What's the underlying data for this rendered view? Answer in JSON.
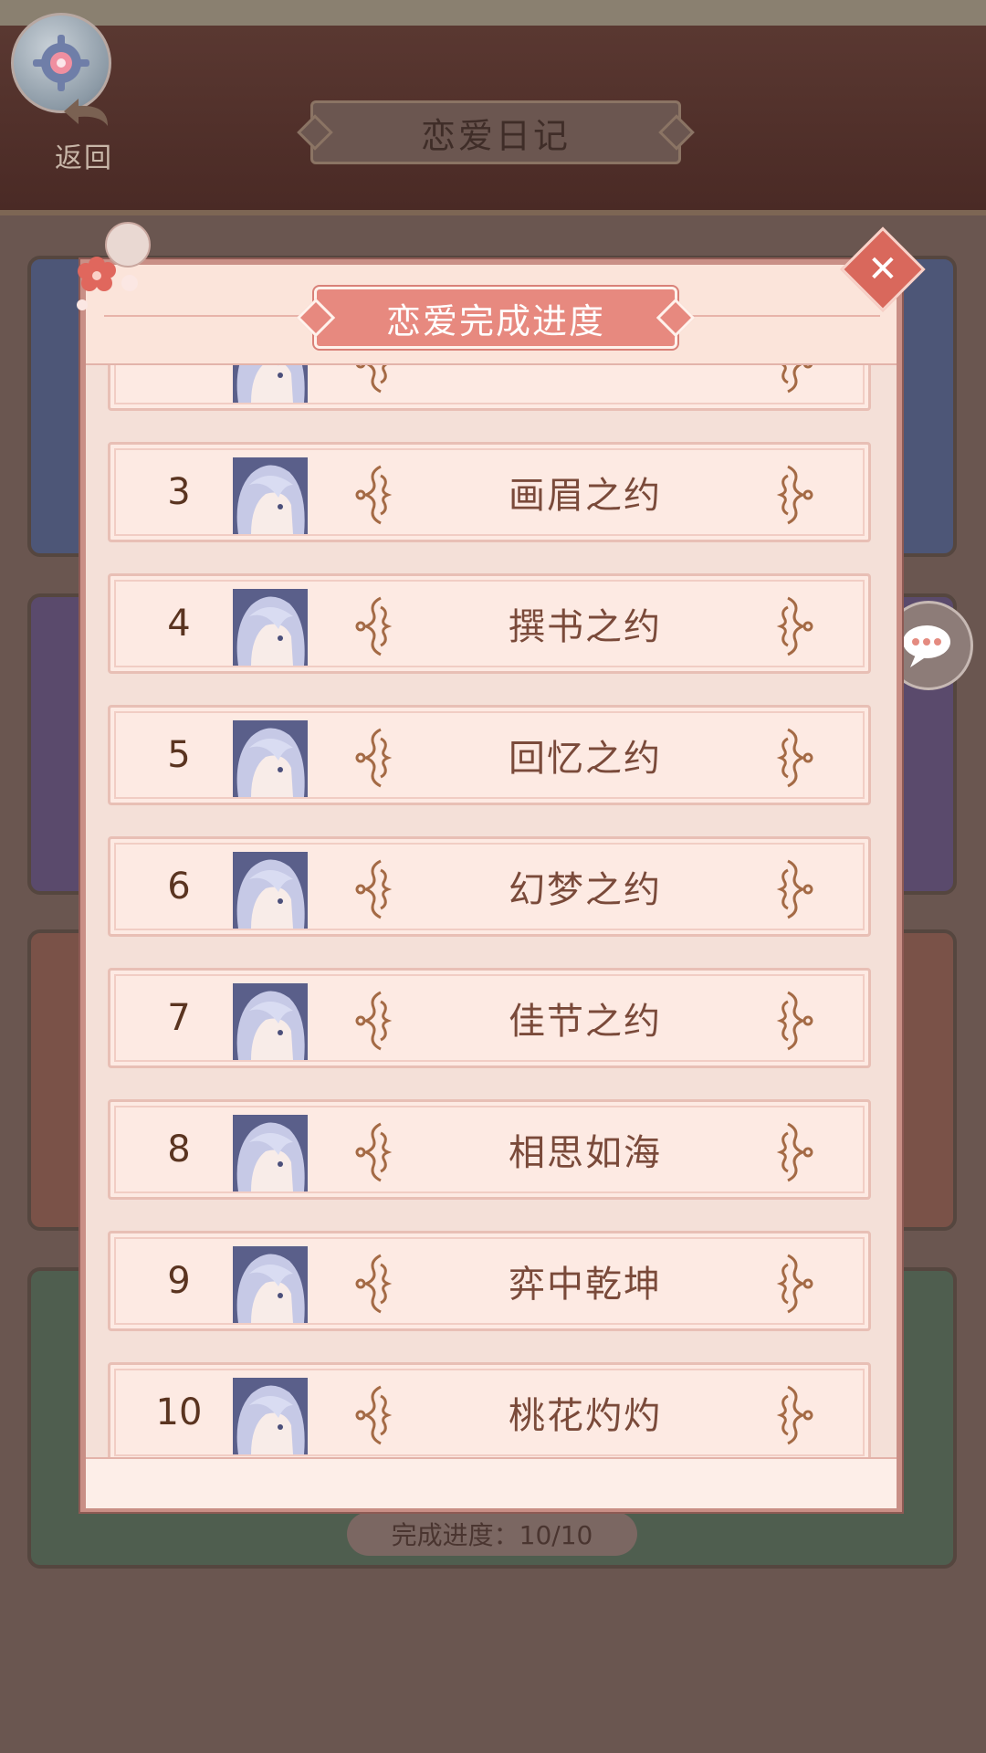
{
  "header": {
    "title": "恋爱日记",
    "back_label": "返回"
  },
  "background": {
    "progress_text": "完成进度：10/10"
  },
  "modal": {
    "title": "恋爱完成进度",
    "close_icon": "close-x-icon",
    "rows": [
      {
        "num": "",
        "name": ""
      },
      {
        "num": "3",
        "name": "画眉之约"
      },
      {
        "num": "4",
        "name": "撰书之约"
      },
      {
        "num": "5",
        "name": "回忆之约"
      },
      {
        "num": "6",
        "name": "幻梦之约"
      },
      {
        "num": "7",
        "name": "佳节之约"
      },
      {
        "num": "8",
        "name": "相思如海"
      },
      {
        "num": "9",
        "name": "弈中乾坤"
      },
      {
        "num": "10",
        "name": "桃花灼灼"
      }
    ]
  },
  "colors": {
    "accent": "#e7897f",
    "panel": "#fbeee6",
    "text_brown": "#7a4a3a"
  }
}
